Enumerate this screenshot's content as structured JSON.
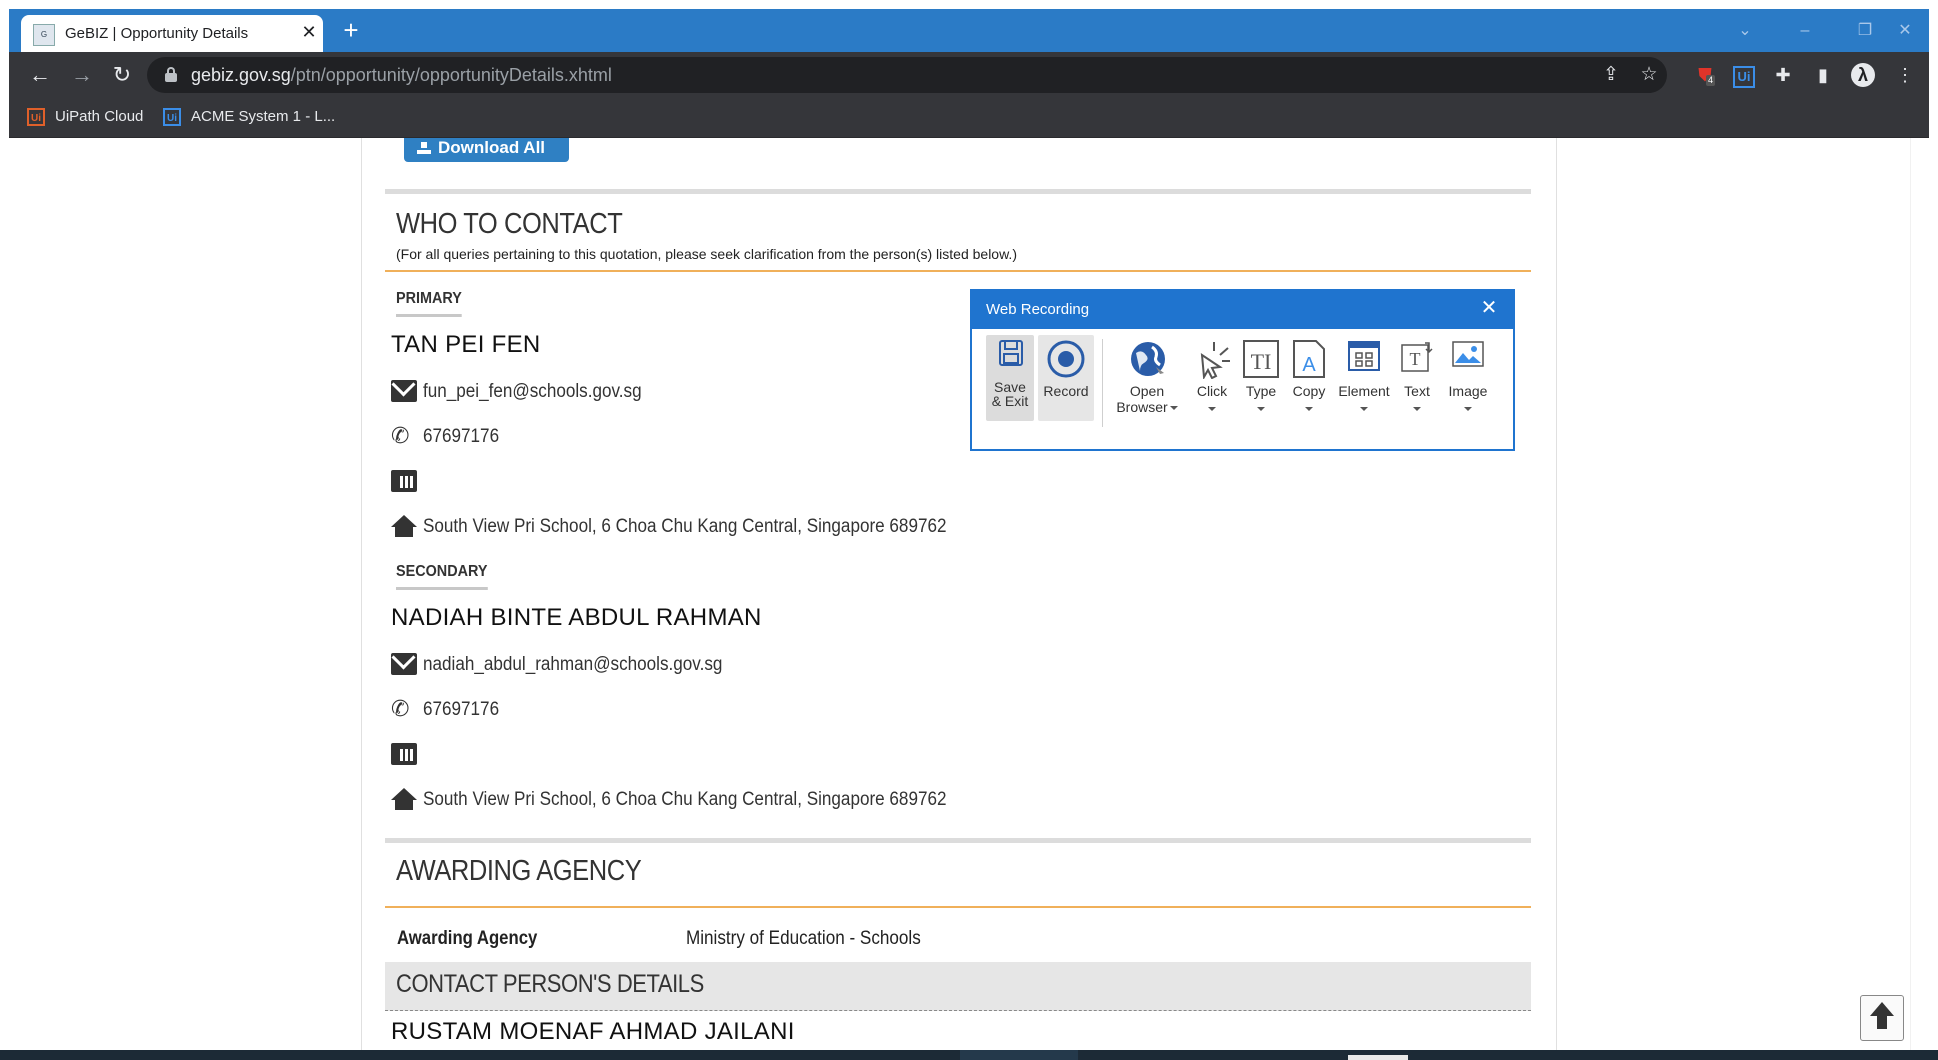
{
  "browser": {
    "tab_title": "GeBIZ | Opportunity Details",
    "tab_close": "✕",
    "new_tab": "+",
    "url_host": "gebiz.gov.sg",
    "url_path": "/ptn/opportunity/opportunityDetails.xhtml",
    "ublock_badge": "4",
    "bookmarks": [
      {
        "label": "UiPath Cloud"
      },
      {
        "label": "ACME System 1 - L..."
      }
    ]
  },
  "page": {
    "download_all": "Download All",
    "who_to_contact": {
      "title": "WHO TO CONTACT",
      "subtitle": "(For all queries pertaining to this quotation, please seek clarification from the person(s) listed below.)",
      "primary": {
        "label": "PRIMARY",
        "name": "TAN PEI FEN",
        "email": "fun_pei_fen@schools.gov.sg",
        "phone": "67697176",
        "fax": "",
        "address": "South View Pri School, 6 Choa Chu Kang Central, Singapore 689762"
      },
      "secondary": {
        "label": "SECONDARY",
        "name": "NADIAH BINTE ABDUL RAHMAN",
        "email": "nadiah_abdul_rahman@schools.gov.sg",
        "phone": "67697176",
        "fax": "",
        "address": "South View Pri School, 6 Choa Chu Kang Central, Singapore 689762"
      }
    },
    "awarding_agency": {
      "title": "AWARDING AGENCY",
      "label": "Awarding Agency",
      "value": "Ministry of Education - Schools"
    },
    "contact_person_details": {
      "title": "CONTACT PERSON'S DETAILS",
      "name": "RUSTAM MOENAF AHMAD JAILANI"
    }
  },
  "web_recording": {
    "title": "Web Recording",
    "close": "✕",
    "buttons": [
      {
        "line1": "Save",
        "line2": "& Exit"
      },
      {
        "line1": "Record"
      },
      {
        "line1": "Open",
        "line2": "Browser"
      },
      {
        "line1": "Click"
      },
      {
        "line1": "Type"
      },
      {
        "line1": "Copy"
      },
      {
        "line1": "Element"
      },
      {
        "line1": "Text"
      },
      {
        "line1": "Image"
      }
    ]
  },
  "colors": {
    "tab_strip": "#2b7bc6",
    "toolbar": "#35363a",
    "recording_accent": "#1f74cf",
    "download_button": "#2f80c3",
    "orange_rule": "#f0b05a"
  }
}
